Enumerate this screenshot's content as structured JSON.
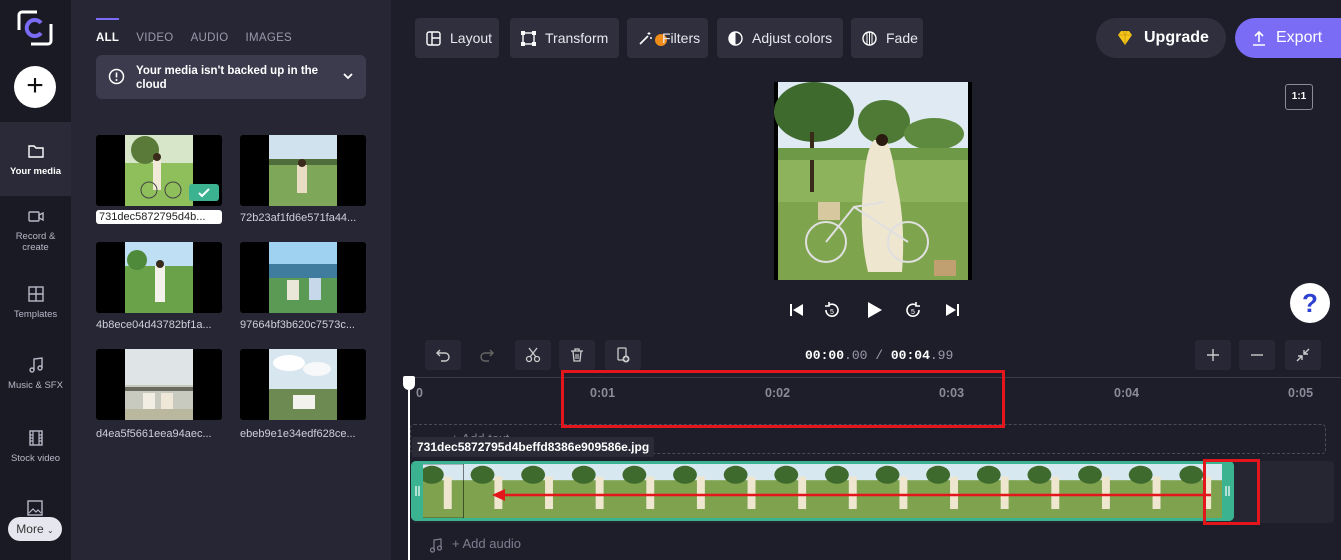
{
  "rail": {
    "items": [
      {
        "label": "Your media",
        "icon": "folder-icon"
      },
      {
        "label": "Record & create",
        "icon": "camera-icon"
      },
      {
        "label": "Templates",
        "icon": "templates-icon"
      },
      {
        "label": "Music & SFX",
        "icon": "music-icon"
      },
      {
        "label": "Stock video",
        "icon": "film-icon"
      }
    ],
    "more_label": "More",
    "add_label": "+"
  },
  "media": {
    "tabs": [
      "ALL",
      "VIDEO",
      "AUDIO",
      "IMAGES"
    ],
    "backup_notice": "Your media isn't backed up in the cloud",
    "items": [
      {
        "name": "731dec5872795d4b..."
      },
      {
        "name": "72b23af1fd6e571fa44..."
      },
      {
        "name": "4b8ece04d43782bf1a..."
      },
      {
        "name": "97664bf3b620c7573c..."
      },
      {
        "name": "d4ea5f5661eea94aec..."
      },
      {
        "name": "ebeb9e1e34edf628ce..."
      }
    ]
  },
  "toolbar": {
    "layout": "Layout",
    "transform": "Transform",
    "filters": "Filters",
    "adjust_colors": "Adjust colors",
    "fade": "Fade",
    "upgrade": "Upgrade",
    "export": "Export",
    "ratio": "1:1"
  },
  "help": {
    "label": "?"
  },
  "timeline": {
    "current_main": "00:00",
    "current_frac": ".00",
    "separator": "/",
    "total_main": "00:04",
    "total_frac": ".99",
    "ruler": [
      "0",
      "0:01",
      "0:02",
      "0:03",
      "0:04",
      "0:05"
    ],
    "add_text": "+ Add text",
    "clip_name": "731dec5872795d4beffd8386e909586e.jpg",
    "add_audio": "+ Add audio"
  },
  "colors": {
    "accent": "#7b6cf6",
    "clip": "#3bb391",
    "annotation": "#e3161b"
  }
}
